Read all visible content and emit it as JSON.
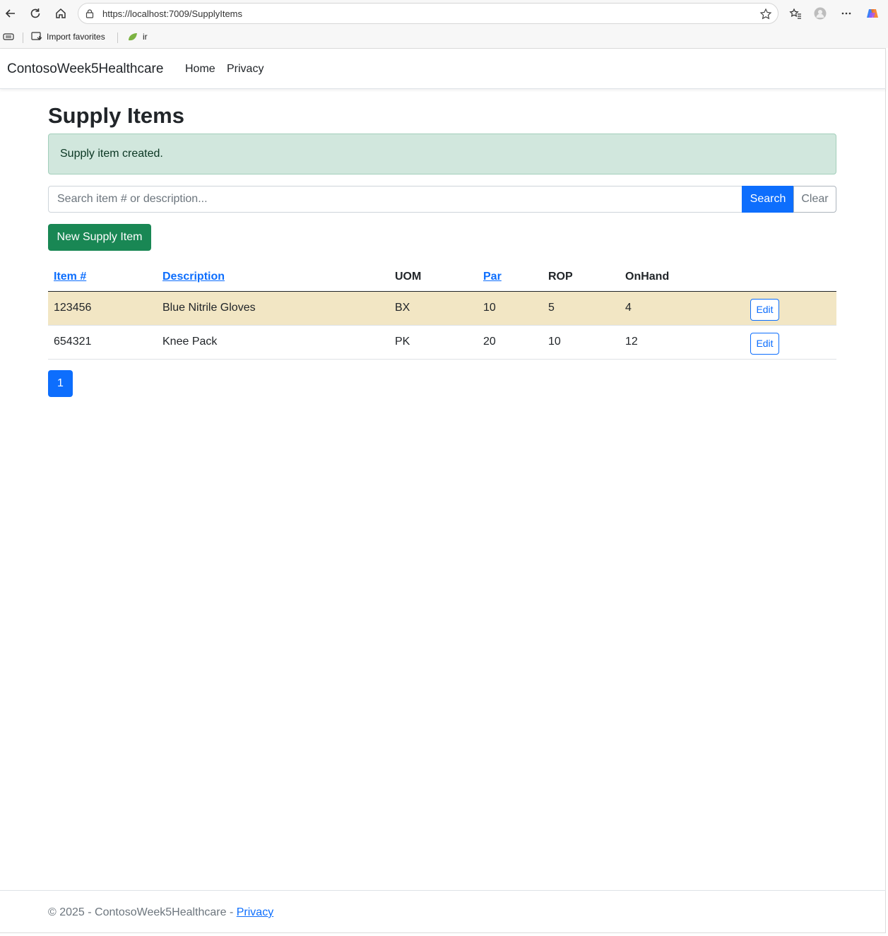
{
  "browser": {
    "url": "https://localhost:7009/SupplyItems",
    "bookmarks": [
      {
        "label": "Import favorites",
        "icon": "import-icon"
      },
      {
        "label": "ir",
        "icon": "leaf-icon"
      }
    ]
  },
  "navbar": {
    "brand": "ContosoWeek5Healthcare",
    "links": [
      "Home",
      "Privacy"
    ]
  },
  "page": {
    "title": "Supply Items",
    "alert": "Supply item created.",
    "search": {
      "placeholder": "Search item # or description...",
      "value": "",
      "search_label": "Search",
      "clear_label": "Clear"
    },
    "new_button": "New Supply Item"
  },
  "table": {
    "headers": [
      {
        "label": "Item #",
        "sortable": true
      },
      {
        "label": "Description",
        "sortable": true
      },
      {
        "label": "UOM",
        "sortable": false
      },
      {
        "label": "Par",
        "sortable": true
      },
      {
        "label": "ROP",
        "sortable": false
      },
      {
        "label": "OnHand",
        "sortable": false
      }
    ],
    "rows": [
      {
        "item": "123456",
        "description": "Blue Nitrile Gloves",
        "uom": "BX",
        "par": "10",
        "rop": "5",
        "onhand": "4",
        "edit": "Edit",
        "highlight": true
      },
      {
        "item": "654321",
        "description": "Knee Pack",
        "uom": "PK",
        "par": "20",
        "rop": "10",
        "onhand": "12",
        "edit": "Edit",
        "highlight": false
      }
    ]
  },
  "pagination": {
    "current": "1"
  },
  "footer": {
    "text": "© 2025 - ContosoWeek5Healthcare - ",
    "link": "Privacy"
  },
  "colors": {
    "primary": "#0d6efd",
    "success": "#198754",
    "alert_bg": "#d1e7dd",
    "highlight_row": "#f2e6c4"
  }
}
